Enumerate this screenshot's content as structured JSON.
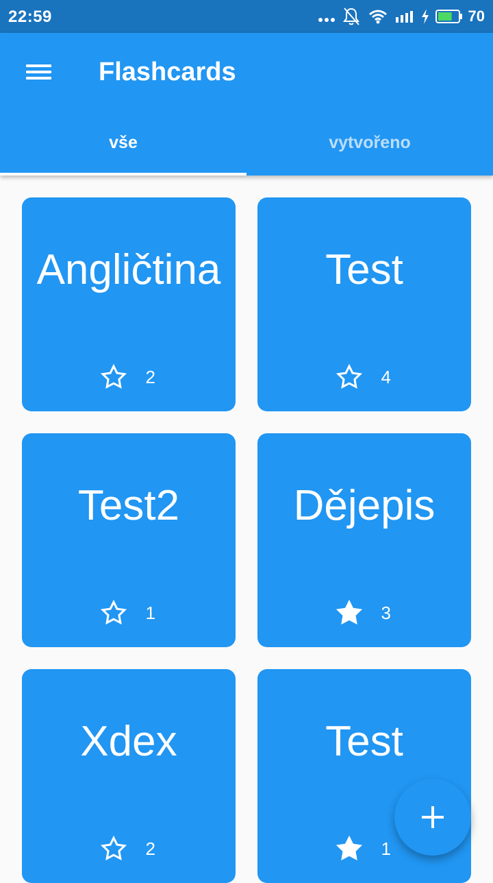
{
  "status_bar": {
    "time": "22:59",
    "battery_level": "70",
    "battery_fraction": 0.7,
    "icons": [
      "more-dots-icon",
      "notifications-off-icon",
      "wifi-icon",
      "signal-icon",
      "charging-icon",
      "battery-icon"
    ]
  },
  "app_bar": {
    "title": "Flashcards",
    "menu_icon": "hamburger-menu-icon",
    "background_color": "#2196f3"
  },
  "tabs": [
    {
      "label": "vše",
      "selected": true
    },
    {
      "label": "vytvořeno",
      "selected": false
    }
  ],
  "cards": [
    {
      "title": "Angličtina",
      "count": "2",
      "starred": false
    },
    {
      "title": "Test",
      "count": "4",
      "starred": false
    },
    {
      "title": "Test2",
      "count": "1",
      "starred": false
    },
    {
      "title": "Dějepis",
      "count": "3",
      "starred": true
    },
    {
      "title": "Xdex",
      "count": "2",
      "starred": false
    },
    {
      "title": "Test",
      "count": "1",
      "starred": true
    }
  ],
  "fab": {
    "icon": "plus-icon"
  },
  "colors": {
    "status_bar": "#1a73bd",
    "primary": "#2196f3",
    "background": "#fafafa",
    "inactive_tab_text": "#bbdefb"
  }
}
